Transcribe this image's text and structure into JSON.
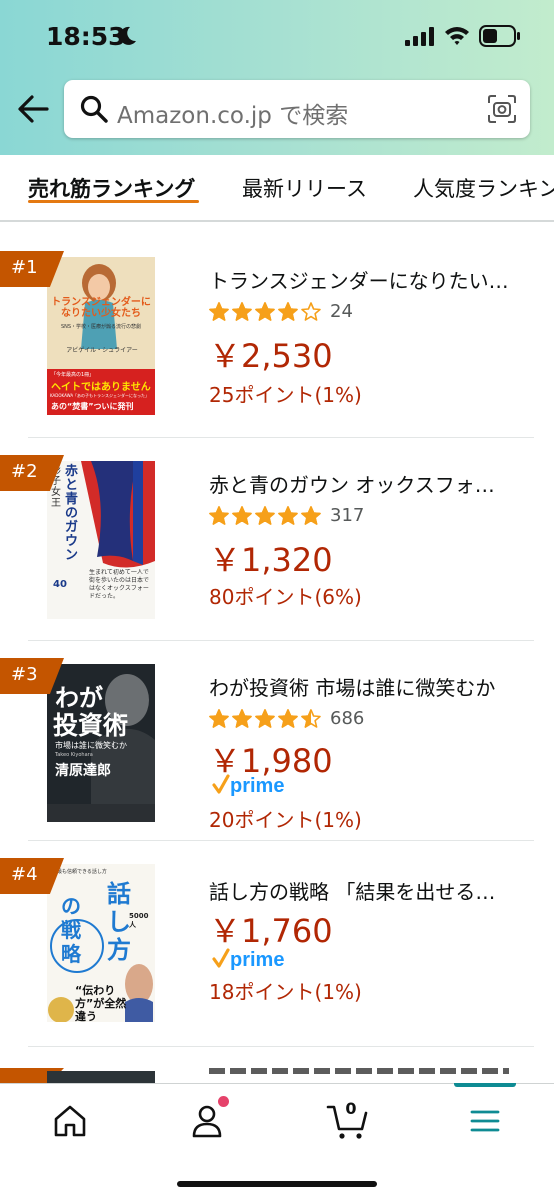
{
  "status_bar": {
    "time": "18:53",
    "icons": [
      "moon-icon",
      "signal-icon",
      "wifi-icon",
      "battery-icon"
    ]
  },
  "search": {
    "placeholder": "Amazon.co.jp で検索",
    "icons": [
      "back-arrow-icon",
      "search-icon",
      "camera-icon"
    ]
  },
  "tabs": [
    {
      "label": "売れ筋ランキング",
      "active": true
    },
    {
      "label": "最新リリース",
      "active": false
    },
    {
      "label": "人気度ランキング",
      "active": false
    }
  ],
  "colors": {
    "accent": "#e47911",
    "price": "#b12704",
    "rank_badge": "#c45500",
    "star": "#f6a01a",
    "prime": "#1a98ff",
    "nav_active": "#0e8b93"
  },
  "products": [
    {
      "rank": "#1",
      "title": "トランスジェンダーになりたい…",
      "rating": 4.0,
      "rating_count": "24",
      "price": "￥2,530",
      "prime": false,
      "points": "25ポイント(1%)",
      "cover": {
        "title": "トランスジェンダーになりたい少女たち",
        "subtitle": "SNS・学校・医療が煽る流行の悲劇",
        "author": "アビゲイル・シュライアー",
        "band_line1": "「今年最高の1冊」",
        "band_line2": "ヘイトではありません",
        "band_line3": "KADOKAWA「あの子もトランスジェンダーになった」",
        "band_line4": "あの“焚書”ついに発刊"
      }
    },
    {
      "rank": "#2",
      "title": "赤と青のガウン オックスフォ…",
      "rating": 5.0,
      "rating_count": "317",
      "price": "￥1,320",
      "prime": false,
      "points": "80ポイント(6%)",
      "cover": {
        "title": "赤と青のガウン",
        "author": "彬子女王",
        "badge": "40",
        "blurb": "生まれて初めて一人で街を歩いたのは日本ではなくオックスフォードだった。"
      }
    },
    {
      "rank": "#3",
      "title": "わが投資術 市場は誰に微笑むか",
      "rating": 4.5,
      "rating_count": "686",
      "price": "￥1,980",
      "prime": true,
      "prime_label": "prime",
      "points": "20ポイント(1%)",
      "cover": {
        "title_line1": "わが",
        "title_line2": "投資術",
        "subtitle": "市場は誰に微笑むか",
        "author_en": "Takeo Kiyohara",
        "author": "清原達郎"
      }
    },
    {
      "rank": "#4",
      "title": "話し方の戦略 「結果を出せる…",
      "rating": null,
      "rating_count": "",
      "price": "￥1,760",
      "prime": true,
      "prime_label": "prime",
      "points": "18ポイント(1%)",
      "cover": {
        "top_line": "最も信頼できる話し方",
        "title_line1": "話し方",
        "title_line2": "の戦略",
        "badge": "5000人",
        "tagline": "“伝わり方”が全然違う"
      }
    }
  ],
  "bottom_nav": {
    "items": [
      {
        "name": "home",
        "icon": "home-icon"
      },
      {
        "name": "account",
        "icon": "account-icon",
        "has_notification": true
      },
      {
        "name": "cart",
        "icon": "cart-icon",
        "count": "0"
      },
      {
        "name": "menu",
        "icon": "menu-icon",
        "active": true
      }
    ]
  }
}
